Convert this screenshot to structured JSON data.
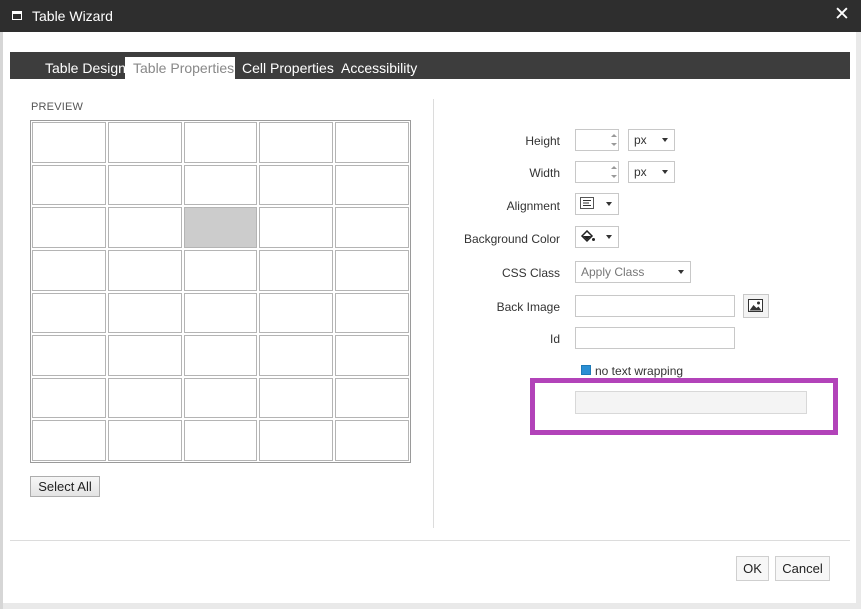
{
  "window": {
    "title": "Table Wizard",
    "close_glyph": "✕"
  },
  "tabs": [
    {
      "label": "Table Design",
      "active": false
    },
    {
      "label": "Table Properties",
      "active": true
    },
    {
      "label": "Cell Properties",
      "active": false
    },
    {
      "label": "Accessibility",
      "active": false
    }
  ],
  "preview": {
    "label": "PREVIEW",
    "rows": 8,
    "cols": 5,
    "selected_cell": {
      "row": 3,
      "col": 3
    },
    "select_all_label": "Select All"
  },
  "form": {
    "height": {
      "label": "Height",
      "value": "",
      "unit": "px"
    },
    "width": {
      "label": "Width",
      "value": "",
      "unit": "px"
    },
    "alignment": {
      "label": "Alignment",
      "icon": "align-left-icon"
    },
    "background_color": {
      "label": "Background Color",
      "icon": "paint-bucket-icon"
    },
    "css_class": {
      "label": "CSS Class",
      "value": "Apply Class"
    },
    "back_image": {
      "label": "Back Image",
      "value": "",
      "icon": "image-icon"
    },
    "id": {
      "label": "Id",
      "value": ""
    },
    "no_text_wrapping": {
      "label": "no text wrapping",
      "checked": true
    }
  },
  "footer": {
    "ok_label": "OK",
    "cancel_label": "Cancel"
  },
  "colors": {
    "highlight": "#b243b9",
    "title_bar": "#2e2e2e",
    "tab_bar": "#3d3d3d",
    "checkbox": "#2a8fd4"
  }
}
